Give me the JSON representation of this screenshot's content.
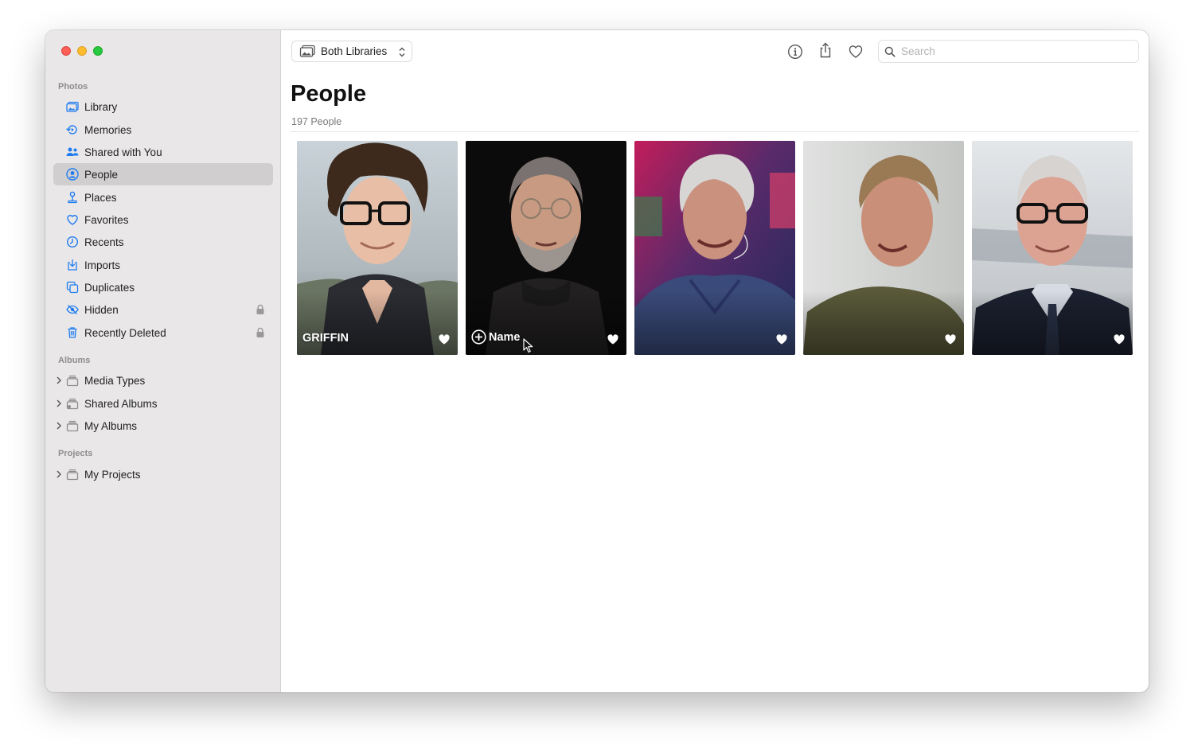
{
  "window": {
    "controls": [
      "close",
      "minimize",
      "zoom"
    ]
  },
  "sidebar": {
    "photos_section": "Photos",
    "items": [
      {
        "label": "Library",
        "icon": "photo-library-icon"
      },
      {
        "label": "Memories",
        "icon": "memories-icon"
      },
      {
        "label": "Shared with You",
        "icon": "shared-with-you-icon"
      },
      {
        "label": "People",
        "icon": "people-icon",
        "selected": true
      },
      {
        "label": "Places",
        "icon": "places-pin-icon"
      },
      {
        "label": "Favorites",
        "icon": "heart-icon"
      },
      {
        "label": "Recents",
        "icon": "clock-icon"
      },
      {
        "label": "Imports",
        "icon": "import-icon"
      },
      {
        "label": "Duplicates",
        "icon": "duplicates-icon"
      },
      {
        "label": "Hidden",
        "icon": "eye-slash-icon",
        "locked": true
      },
      {
        "label": "Recently Deleted",
        "icon": "trash-icon",
        "locked": true
      }
    ],
    "albums_section": "Albums",
    "albums": [
      {
        "label": "Media Types",
        "icon": "folder-icon"
      },
      {
        "label": "Shared Albums",
        "icon": "shared-folder-icon"
      },
      {
        "label": "My Albums",
        "icon": "folder-icon"
      }
    ],
    "projects_section": "Projects",
    "projects": [
      {
        "label": "My Projects",
        "icon": "folder-icon"
      }
    ]
  },
  "toolbar": {
    "library_selector": "Both Libraries",
    "buttons": [
      "info-icon",
      "share-icon",
      "favorite-heart-icon"
    ],
    "search_placeholder": "Search"
  },
  "main": {
    "title": "People",
    "count": "197 People",
    "people": [
      {
        "name": "GRIFFIN",
        "favorite": true
      },
      {
        "name": "Name",
        "unnamed": true,
        "favorite": true
      },
      {
        "name": "",
        "favorite": true
      },
      {
        "name": "",
        "favorite": true
      },
      {
        "name": "",
        "favorite": true
      }
    ]
  },
  "colors": {
    "accent": "#1f7cf0",
    "sidebar_bg": "#e9e7e8",
    "selected_bg": "#d0cecf",
    "close": "#fe5f57",
    "minimize": "#febc2e",
    "zoom": "#28c840"
  }
}
